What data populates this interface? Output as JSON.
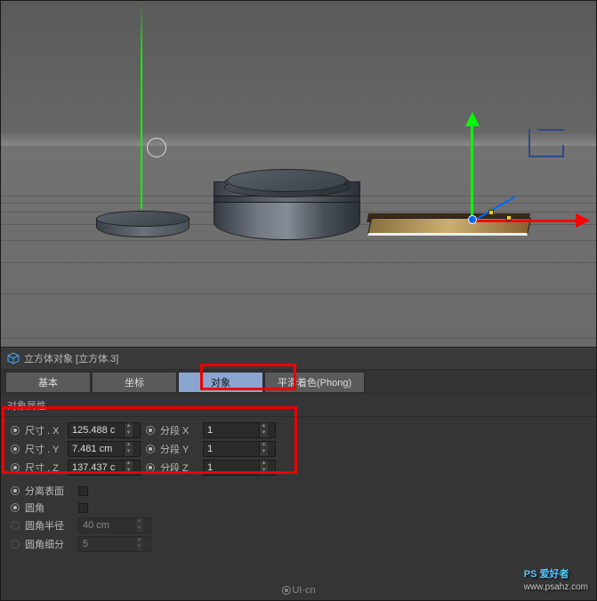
{
  "header": {
    "icon": "cube-icon",
    "title": "立方体对象 [立方体.3]"
  },
  "tabs": {
    "basic": "基本",
    "coord": "坐标",
    "object": "对象",
    "phong": "平滑着色(Phong)"
  },
  "section_title": "对象属性",
  "props": {
    "size_x": {
      "label": "尺寸 . X",
      "value": "125.488 c"
    },
    "size_y": {
      "label": "尺寸 . Y",
      "value": "7.481 cm"
    },
    "size_z": {
      "label": "尺寸 . Z",
      "value": "137.437 c"
    },
    "seg_x": {
      "label": "分段 X",
      "value": "1"
    },
    "seg_y": {
      "label": "分段 Y",
      "value": "1"
    },
    "seg_z": {
      "label": "分段 Z",
      "value": "1"
    },
    "separate": {
      "label": "分离表面"
    },
    "fillet": {
      "label": "圆角"
    },
    "fillet_radius": {
      "label": "圆角半径",
      "value": "40 cm"
    },
    "fillet_sub": {
      "label": "圆角细分",
      "value": "5"
    }
  },
  "footer": {
    "logo": "UI·cn"
  },
  "watermark": {
    "brand": "PS 爱好者",
    "url": "www.psahz.com"
  }
}
